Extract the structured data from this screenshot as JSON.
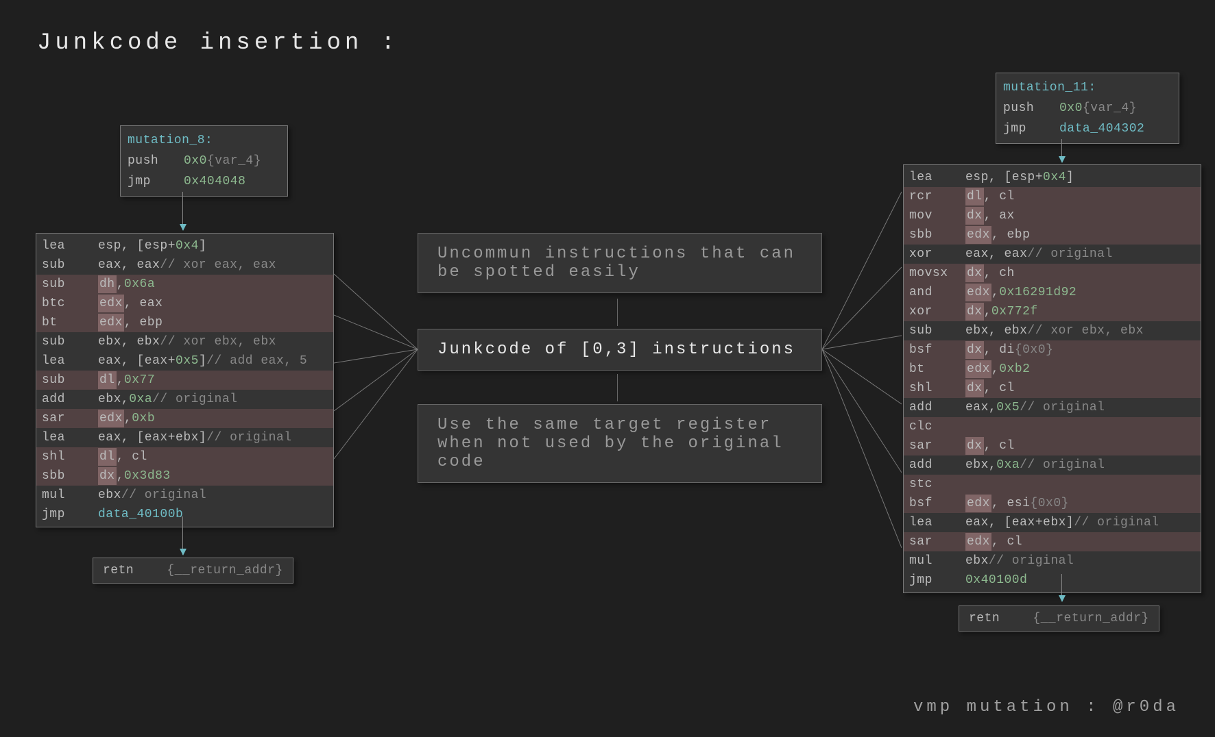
{
  "title": "Junkcode insertion :",
  "left": {
    "header_label": "mutation_8",
    "header": [
      {
        "op": "push",
        "args": [
          {
            "t": "0x0 ",
            "c": "green"
          },
          {
            "t": "{var_4}",
            "c": "dim"
          }
        ]
      },
      {
        "op": "jmp",
        "args": [
          {
            "t": "0x404048",
            "c": "green"
          }
        ]
      }
    ],
    "body": [
      {
        "shade": false,
        "op": "lea",
        "args": [
          {
            "t": "esp"
          },
          {
            "t": ", [esp+"
          },
          {
            "t": "0x4",
            "c": "green"
          },
          {
            "t": "]"
          }
        ]
      },
      {
        "shade": false,
        "op": "sub",
        "args": [
          {
            "t": "eax"
          },
          {
            "t": ", eax"
          },
          {
            "t": "  // xor eax, eax",
            "c": "dim"
          }
        ]
      },
      {
        "shade": true,
        "op": "sub",
        "args": [
          {
            "t": "dh",
            "hl": true
          },
          {
            "t": ", "
          },
          {
            "t": "0x6a",
            "c": "green"
          }
        ]
      },
      {
        "shade": true,
        "op": "btc",
        "args": [
          {
            "t": "edx",
            "hl": true
          },
          {
            "t": ", eax"
          }
        ]
      },
      {
        "shade": true,
        "op": "bt",
        "args": [
          {
            "t": "edx",
            "hl": true
          },
          {
            "t": ", ebp"
          }
        ]
      },
      {
        "shade": false,
        "op": "sub",
        "args": [
          {
            "t": "ebx"
          },
          {
            "t": ", ebx"
          },
          {
            "t": "  // xor ebx, ebx",
            "c": "dim"
          }
        ]
      },
      {
        "shade": false,
        "op": "lea",
        "args": [
          {
            "t": "eax"
          },
          {
            "t": ", [eax+"
          },
          {
            "t": "0x5",
            "c": "green"
          },
          {
            "t": "]"
          },
          {
            "t": "  // add eax, 5",
            "c": "dim"
          }
        ]
      },
      {
        "shade": true,
        "op": "sub",
        "args": [
          {
            "t": "dl",
            "hl": true
          },
          {
            "t": ", "
          },
          {
            "t": "0x77",
            "c": "green"
          }
        ]
      },
      {
        "shade": false,
        "op": "add",
        "args": [
          {
            "t": "ebx"
          },
          {
            "t": ", "
          },
          {
            "t": "0xa",
            "c": "green"
          },
          {
            "t": "  // original",
            "c": "dim"
          }
        ]
      },
      {
        "shade": true,
        "op": "sar",
        "args": [
          {
            "t": "edx",
            "hl": true
          },
          {
            "t": ", "
          },
          {
            "t": "0xb",
            "c": "green"
          }
        ]
      },
      {
        "shade": false,
        "op": "lea",
        "args": [
          {
            "t": "eax"
          },
          {
            "t": ", [eax+ebx]"
          },
          {
            "t": "  // original",
            "c": "dim"
          }
        ]
      },
      {
        "shade": true,
        "op": "shl",
        "args": [
          {
            "t": "dl",
            "hl": true
          },
          {
            "t": ", cl"
          }
        ]
      },
      {
        "shade": true,
        "op": "sbb",
        "args": [
          {
            "t": "dx",
            "hl": true
          },
          {
            "t": ", "
          },
          {
            "t": "0x3d83",
            "c": "green"
          }
        ]
      },
      {
        "shade": false,
        "op": "mul",
        "args": [
          {
            "t": "ebx"
          },
          {
            "t": "  // original",
            "c": "dim"
          }
        ]
      },
      {
        "shade": false,
        "op": "jmp",
        "args": [
          {
            "t": "data_40100b",
            "c": "cyan"
          }
        ]
      }
    ],
    "retn_op": "retn",
    "retn_arg": "{__return_addr}"
  },
  "right": {
    "header_label": "mutation_11",
    "header": [
      {
        "op": "push",
        "args": [
          {
            "t": "0x0 ",
            "c": "green"
          },
          {
            "t": "{var_4}",
            "c": "dim"
          }
        ]
      },
      {
        "op": "jmp",
        "args": [
          {
            "t": "data_404302",
            "c": "cyan"
          }
        ]
      }
    ],
    "body": [
      {
        "shade": false,
        "op": "lea",
        "args": [
          {
            "t": "esp"
          },
          {
            "t": ", [esp+"
          },
          {
            "t": "0x4",
            "c": "green"
          },
          {
            "t": "]"
          }
        ]
      },
      {
        "shade": true,
        "op": "rcr",
        "args": [
          {
            "t": "dl",
            "hl": true
          },
          {
            "t": ", cl"
          }
        ]
      },
      {
        "shade": true,
        "op": "mov",
        "args": [
          {
            "t": "dx",
            "hl": true
          },
          {
            "t": ", ax"
          }
        ]
      },
      {
        "shade": true,
        "op": "sbb",
        "args": [
          {
            "t": "edx",
            "hl": true
          },
          {
            "t": ", ebp"
          }
        ]
      },
      {
        "shade": false,
        "op": "xor",
        "args": [
          {
            "t": "eax"
          },
          {
            "t": ", eax"
          },
          {
            "t": "  // original",
            "c": "dim"
          }
        ]
      },
      {
        "shade": true,
        "op": "movsx",
        "args": [
          {
            "t": "dx",
            "hl": true
          },
          {
            "t": ", ch"
          }
        ]
      },
      {
        "shade": true,
        "op": "and",
        "args": [
          {
            "t": "edx",
            "hl": true
          },
          {
            "t": ", "
          },
          {
            "t": "0x16291d92",
            "c": "green"
          }
        ]
      },
      {
        "shade": true,
        "op": "xor",
        "args": [
          {
            "t": "dx",
            "hl": true
          },
          {
            "t": ", "
          },
          {
            "t": "0x772f",
            "c": "green"
          }
        ]
      },
      {
        "shade": false,
        "op": "sub",
        "args": [
          {
            "t": "ebx"
          },
          {
            "t": ", ebx"
          },
          {
            "t": "  // xor ebx, ebx",
            "c": "dim"
          }
        ]
      },
      {
        "shade": true,
        "op": "bsf",
        "args": [
          {
            "t": "dx",
            "hl": true
          },
          {
            "t": ", di  "
          },
          {
            "t": "{0x0}",
            "c": "dim"
          }
        ]
      },
      {
        "shade": true,
        "op": "bt",
        "args": [
          {
            "t": "edx",
            "hl": true
          },
          {
            "t": ", "
          },
          {
            "t": "0xb2",
            "c": "green"
          }
        ]
      },
      {
        "shade": true,
        "op": "shl",
        "args": [
          {
            "t": "dx",
            "hl": true
          },
          {
            "t": ", cl"
          }
        ]
      },
      {
        "shade": false,
        "op": "add",
        "args": [
          {
            "t": "eax"
          },
          {
            "t": ", "
          },
          {
            "t": "0x5",
            "c": "green"
          },
          {
            "t": "  // original",
            "c": "dim"
          }
        ]
      },
      {
        "shade": true,
        "op": "clc",
        "args": []
      },
      {
        "shade": true,
        "op": "sar",
        "args": [
          {
            "t": "dx",
            "hl": true
          },
          {
            "t": ", cl"
          }
        ]
      },
      {
        "shade": false,
        "op": "add",
        "args": [
          {
            "t": "ebx"
          },
          {
            "t": ", "
          },
          {
            "t": "0xa",
            "c": "green"
          },
          {
            "t": "  // original",
            "c": "dim"
          }
        ]
      },
      {
        "shade": true,
        "op": "stc",
        "args": []
      },
      {
        "shade": true,
        "op": "bsf",
        "args": [
          {
            "t": "edx",
            "hl": true
          },
          {
            "t": ", esi  "
          },
          {
            "t": "{0x0}",
            "c": "dim"
          }
        ]
      },
      {
        "shade": false,
        "op": "lea",
        "args": [
          {
            "t": "eax"
          },
          {
            "t": ", [eax+ebx]"
          },
          {
            "t": "  // original",
            "c": "dim"
          }
        ]
      },
      {
        "shade": true,
        "op": "sar",
        "args": [
          {
            "t": "edx",
            "hl": true
          },
          {
            "t": ", cl"
          }
        ]
      },
      {
        "shade": false,
        "op": "mul",
        "args": [
          {
            "t": "ebx"
          },
          {
            "t": "  // original",
            "c": "dim"
          }
        ]
      },
      {
        "shade": false,
        "op": "jmp",
        "args": [
          {
            "t": "0x40100d",
            "c": "green"
          }
        ]
      }
    ],
    "retn_op": "retn",
    "retn_arg": "{__return_addr}"
  },
  "notes": {
    "top": "Uncommun instructions that can be spotted easily",
    "mid": "Junkcode of [0,3] instructions",
    "bot": "Use the same target register when not used by the original code"
  },
  "footer": "vmp mutation : @r0da"
}
